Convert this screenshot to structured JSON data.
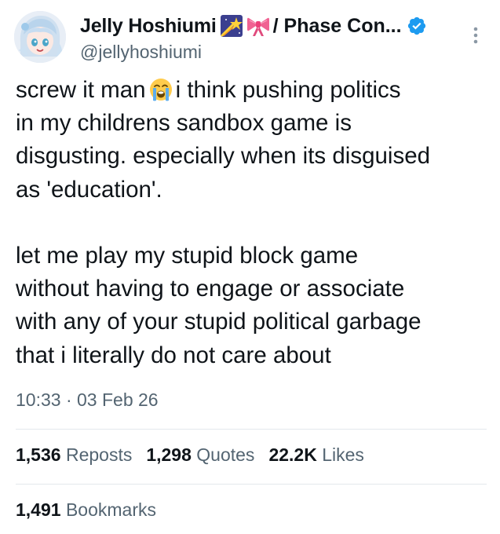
{
  "author": {
    "display_name": "Jelly Hoshiumi",
    "name_suffix": "/ Phase Con...",
    "handle": "@jellyhoshiumi",
    "badges": [
      "shooting-star-icon",
      "ribbon-icon"
    ],
    "verified_color": "#1d9bf0"
  },
  "tweet": {
    "lines": [
      {
        "before": "screw it man",
        "emoji": "loudly-crying-face-icon",
        "after": "i think pushing politics"
      },
      {
        "text": "in my childrens sandbox game is"
      },
      {
        "text": "disgusting. especially when its disguised"
      },
      {
        "text": "as 'education'."
      },
      {
        "text": ""
      },
      {
        "text": "let me play my stupid block game"
      },
      {
        "text": "without having to engage or associate"
      },
      {
        "text": "with any of your stupid political garbage"
      },
      {
        "text": "that i literally do not care about"
      }
    ]
  },
  "meta": {
    "time": "10:33",
    "separator": "·",
    "date": "03 Feb 26"
  },
  "stats": {
    "reposts": {
      "value": "1,536",
      "label": "Reposts"
    },
    "quotes": {
      "value": "1,298",
      "label": "Quotes"
    },
    "likes": {
      "value": "22.2K",
      "label": "Likes"
    },
    "bookmarks": {
      "value": "1,491",
      "label": "Bookmarks"
    }
  },
  "colors": {
    "text": "#0f1419",
    "secondary": "#536471",
    "divider": "#e3e8ec",
    "accent": "#1d9bf0"
  }
}
